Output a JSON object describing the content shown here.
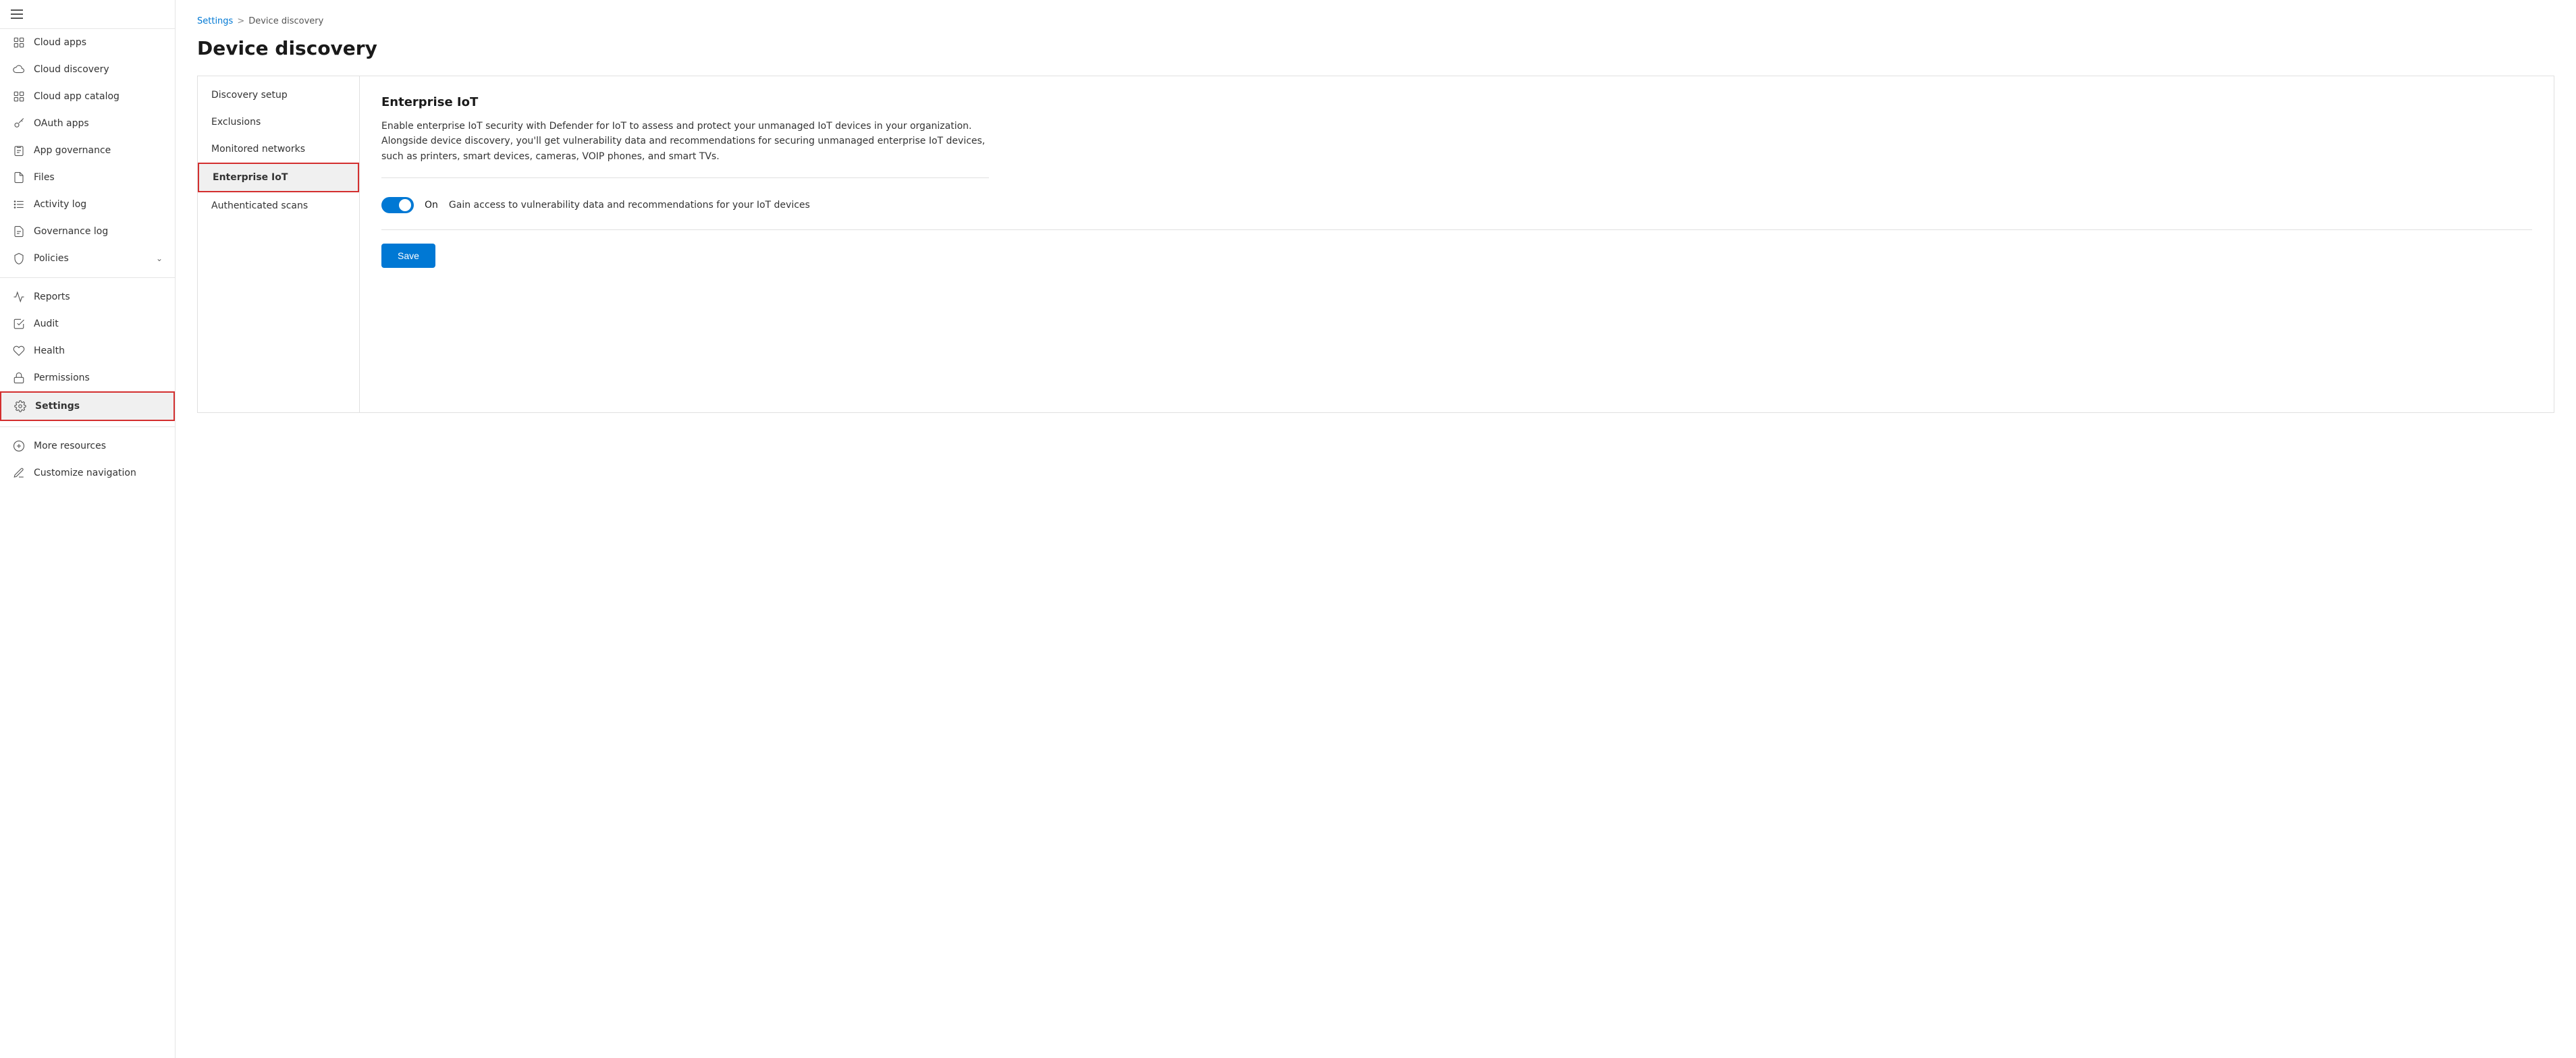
{
  "sidebar": {
    "header_icon": "menu",
    "items": [
      {
        "id": "cloud-apps",
        "label": "Cloud apps",
        "icon": "grid",
        "active": false
      },
      {
        "id": "cloud-discovery",
        "label": "Cloud discovery",
        "icon": "cloud",
        "active": false
      },
      {
        "id": "cloud-app-catalog",
        "label": "Cloud app catalog",
        "icon": "apps",
        "active": false
      },
      {
        "id": "oauth-apps",
        "label": "OAuth apps",
        "icon": "key",
        "active": false
      },
      {
        "id": "app-governance",
        "label": "App governance",
        "icon": "clipboard",
        "active": false
      },
      {
        "id": "files",
        "label": "Files",
        "icon": "file",
        "active": false
      },
      {
        "id": "activity-log",
        "label": "Activity log",
        "icon": "list",
        "active": false
      },
      {
        "id": "governance-log",
        "label": "Governance log",
        "icon": "document",
        "active": false
      },
      {
        "id": "policies",
        "label": "Policies",
        "icon": "shield",
        "active": false,
        "hasChevron": true
      },
      {
        "id": "reports",
        "label": "Reports",
        "icon": "chart",
        "active": false
      },
      {
        "id": "audit",
        "label": "Audit",
        "icon": "checklist",
        "active": false
      },
      {
        "id": "health",
        "label": "Health",
        "icon": "heart",
        "active": false
      },
      {
        "id": "permissions",
        "label": "Permissions",
        "icon": "lock",
        "active": false
      },
      {
        "id": "settings",
        "label": "Settings",
        "icon": "gear",
        "active": true
      }
    ],
    "bottom_items": [
      {
        "id": "more-resources",
        "label": "More resources",
        "icon": "external"
      },
      {
        "id": "customize-navigation",
        "label": "Customize navigation",
        "icon": "edit"
      }
    ]
  },
  "breadcrumb": {
    "parent": "Settings",
    "separator": ">",
    "current": "Device discovery"
  },
  "page": {
    "title": "Device discovery"
  },
  "sub_nav": {
    "items": [
      {
        "id": "discovery-setup",
        "label": "Discovery setup",
        "active": false
      },
      {
        "id": "exclusions",
        "label": "Exclusions",
        "active": false
      },
      {
        "id": "monitored-networks",
        "label": "Monitored networks",
        "active": false
      },
      {
        "id": "enterprise-iot",
        "label": "Enterprise IoT",
        "active": true
      },
      {
        "id": "authenticated-scans",
        "label": "Authenticated scans",
        "active": false
      }
    ]
  },
  "detail": {
    "title": "Enterprise IoT",
    "description": "Enable enterprise IoT security with Defender for IoT to assess and protect your unmanaged IoT devices in your organization. Alongside device discovery, you'll get vulnerability data and recommendations for securing unmanaged enterprise IoT devices, such as printers, smart devices, cameras, VOIP phones, and smart TVs.",
    "toggle": {
      "enabled": true,
      "label": "On",
      "description": "Gain access to vulnerability data and recommendations for your IoT devices"
    },
    "save_button": "Save"
  }
}
